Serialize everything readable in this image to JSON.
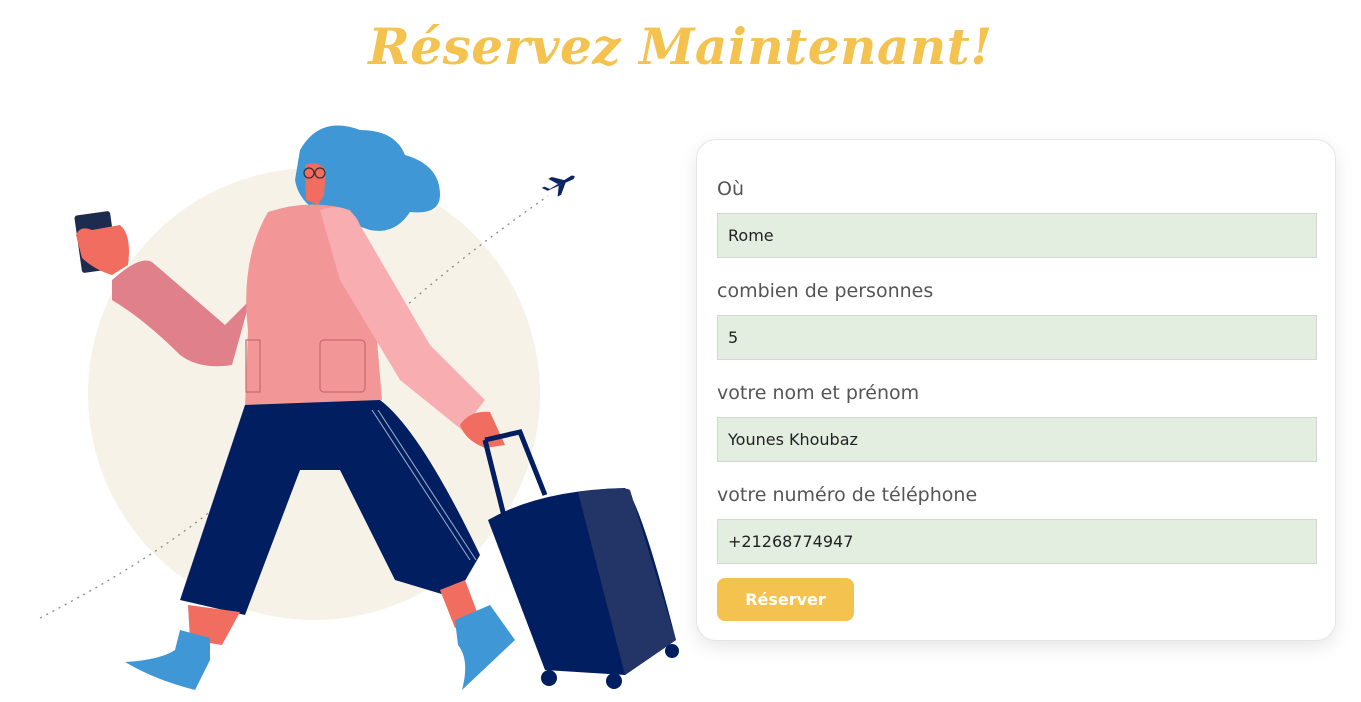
{
  "colors": {
    "accent": "#f4c24f",
    "input_bg": "#e3eee1",
    "label": "#555555"
  },
  "header": {
    "title": "Réservez Maintenant!"
  },
  "form": {
    "fields": [
      {
        "label": "Où",
        "value": "Rome"
      },
      {
        "label": "combien de personnes",
        "value": "5"
      },
      {
        "label": "votre nom et prénom",
        "value": "Younes Khoubaz"
      },
      {
        "label": "votre numéro de téléphone",
        "value": "+21268774947"
      }
    ],
    "submit_label": "Réserver"
  },
  "illustration": {
    "icon": "traveler-with-suitcase-illustration",
    "plane_icon": "airplane-icon"
  }
}
